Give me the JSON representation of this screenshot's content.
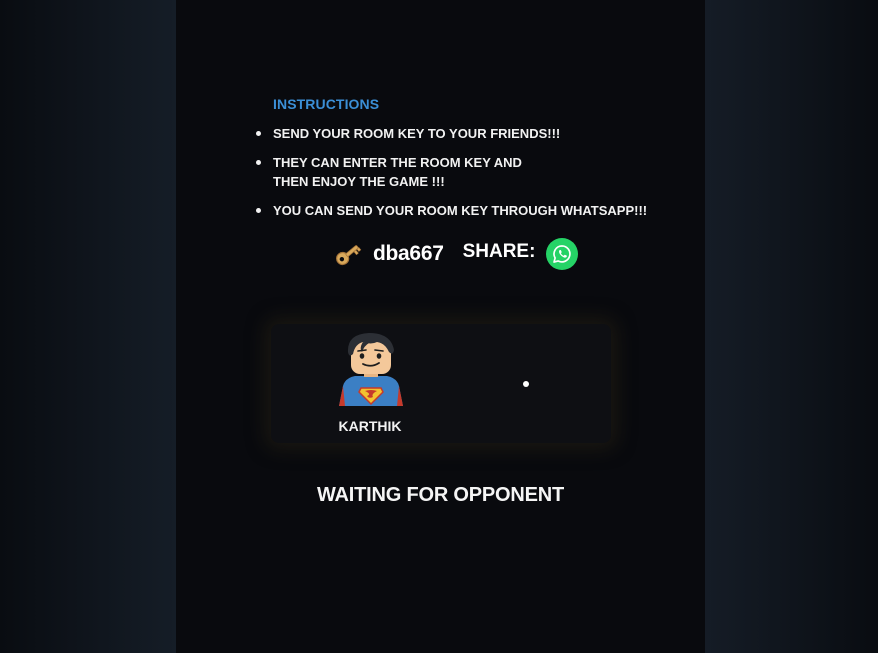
{
  "instructions": {
    "title": "INSTRUCTIONS",
    "items": [
      "SEND YOUR ROOM KEY TO YOUR FRIENDS!!!",
      "THEY CAN ENTER THE ROOM KEY AND THEN ENJOY THE GAME !!!",
      "YOU CAN SEND YOUR ROOM KEY THROUGH WHATSAPP!!!"
    ]
  },
  "room": {
    "key_icon": "key-icon",
    "key": "dba667",
    "share_label": "SHARE:",
    "share_icon": "whatsapp-icon"
  },
  "players": {
    "player1": {
      "name": "KARTHIK",
      "avatar": "superman-lego-avatar"
    },
    "opponent_status_icon": "loading-dot"
  },
  "status": {
    "message": "WAITING FOR OPPONENT"
  },
  "colors": {
    "accent": "#3b8fd6",
    "whatsapp": "#25d366",
    "background": "#090a0e"
  }
}
